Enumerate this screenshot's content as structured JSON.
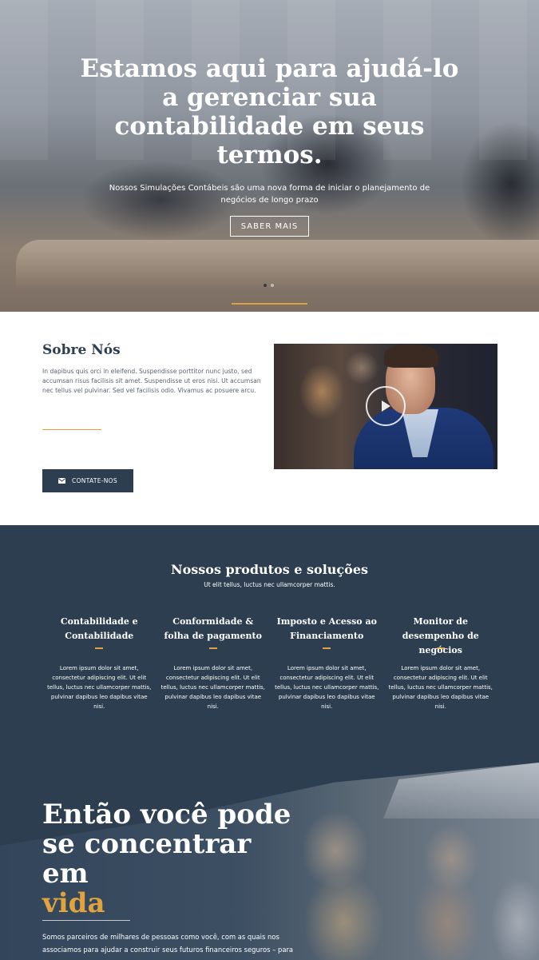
{
  "hero": {
    "title": "Estamos aqui para ajudá-lo a gerenciar sua contabilidade em seus termos.",
    "subtitle": "Nossos Simulações Contábeis são uma nova forma de iniciar o planejamento de negócios de longo prazo",
    "button_label": "SABER MAIS",
    "slides_count": 2,
    "active_slide": 1
  },
  "about": {
    "title": "Sobre Nós",
    "text": "In dapibus quis orci in eleifend. Suspendisse porttitor nunc justo, sed accumsan risus facilisis sit amet. Suspendisse ut eros nisi. Ut accumsan nec tellus vel pulvinar. Sed vel facilisis odio. Vivamus ac posuere arcu.",
    "button_label": "CONTATE-NOS",
    "button_icon": "mail-icon",
    "video_icon": "play-icon"
  },
  "products": {
    "title": "Nossos produtos e soluções",
    "subtitle": "Ut elit tellus, luctus nec ullamcorper mattis.",
    "items": [
      {
        "title": "Contabilidade e Contabilidade",
        "text": "Lorem ipsum dolor sit amet, consectetur adipiscing elit. Ut elit tellus, luctus nec ullamcorper mattis, pulvinar dapibus leo dapibus vitae nisi."
      },
      {
        "title": "Conformidade & folha de pagamento",
        "text": "Lorem ipsum dolor sit amet, consectetur adipiscing elit. Ut elit tellus, luctus nec ullamcorper mattis, pulvinar dapibus leo dapibus vitae nisi."
      },
      {
        "title": "Imposto e Acesso ao Financiamento",
        "text": "Lorem ipsum dolor sit amet, consectetur adipiscing elit. Ut elit tellus, luctus nec ullamcorper mattis, pulvinar dapibus leo dapibus vitae nisi."
      },
      {
        "title": "Monitor de desempenho de negócios",
        "text": "Lorem ipsum dolor sit amet, consectetur adipiscing elit. Ut elit tellus, luctus nec ullamcorper mattis, pulvinar dapibus leo dapibus vitae nisi."
      }
    ]
  },
  "focus": {
    "title": "Então você pode se concentrar em",
    "title_accent": "vida",
    "text": "Somos parceiros de milhares de pessoas como você, com as quais nos associamos para ajudar a construir seus futuros financeiros seguros – para"
  },
  "colors": {
    "primary": "#2c3e50",
    "accent": "#e0a33d",
    "white": "#ffffff"
  }
}
